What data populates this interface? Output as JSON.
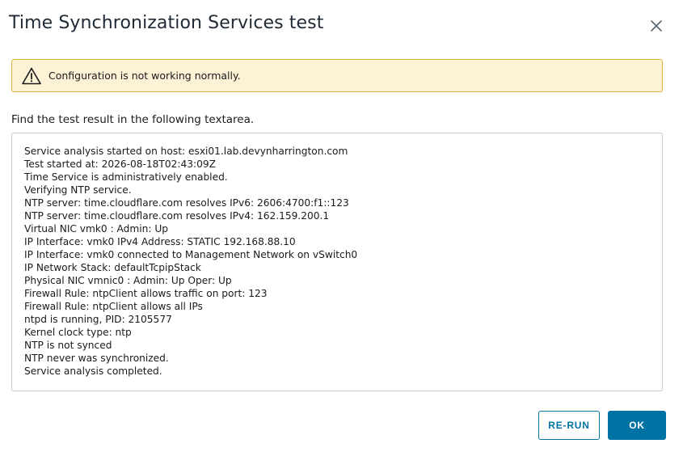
{
  "dialog": {
    "title": "Time Synchronization Services test",
    "close_icon": "close-icon"
  },
  "alert": {
    "icon": "warning-triangle-icon",
    "message": "Configuration is not working normally.",
    "colors": {
      "background": "#fdf2d6",
      "border": "#e8b23c"
    }
  },
  "instruction": "Find the test result in the following textarea.",
  "result_lines": [
    "Service analysis started on host: esxi01.lab.devynharrington.com",
    "Test started at: 2026-08-18T02:43:09Z",
    "Time Service is administratively enabled.",
    "Verifying NTP service.",
    "NTP server: time.cloudflare.com resolves IPv6: 2606:4700:f1::123",
    "NTP server: time.cloudflare.com resolves IPv4: 162.159.200.1",
    "Virtual NIC vmk0 : Admin: Up",
    "IP Interface: vmk0 IPv4 Address: STATIC 192.168.88.10",
    "IP Interface: vmk0 connected to Management Network on vSwitch0",
    "IP Network Stack: defaultTcpipStack",
    "Physical NIC vmnic0 : Admin: Up Oper: Up",
    "Firewall Rule: ntpClient allows traffic on port: 123",
    "Firewall Rule: ntpClient allows all IPs",
    "ntpd is running, PID: 2105577",
    "Kernel clock type: ntp",
    "NTP is not synced",
    "NTP never was synchronized.",
    "Service analysis completed."
  ],
  "buttons": {
    "rerun_label": "RE-RUN",
    "ok_label": "OK"
  },
  "colors": {
    "accent": "#0072a3"
  }
}
